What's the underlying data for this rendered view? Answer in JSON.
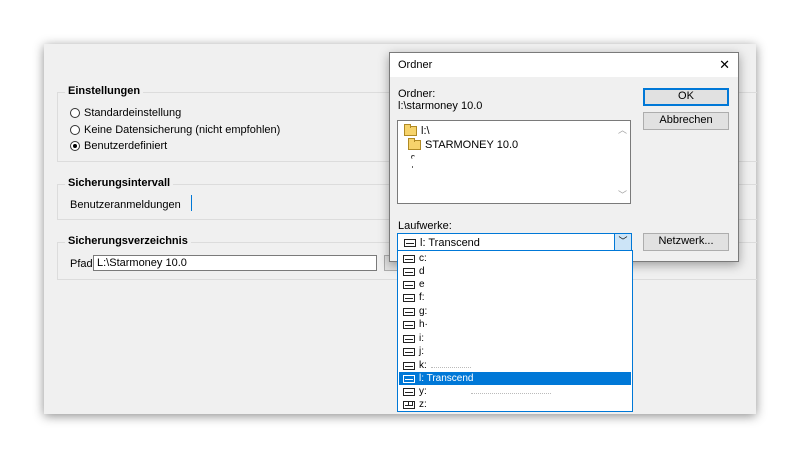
{
  "settings": {
    "group_einstellungen": "Einstellungen",
    "radio_standard": "Standardeinstellung",
    "radio_keine": "Keine Datensicherung (nicht empfohlen)",
    "radio_benutzer": "Benutzerdefiniert",
    "group_intervall": "Sicherungsintervall",
    "intervall_label": "Benutzeranmeldungen",
    "group_verzeichnis": "Sicherungsverzeichnis",
    "pfad_label": "Pfad",
    "pfad_value": "L:\\Starmoney 10.0"
  },
  "dialog": {
    "title": "Ordner",
    "close_glyph": "✕",
    "ordner_label": "Ordner:",
    "ordner_path": "l:\\starmoney 10.0",
    "ok_label": "OK",
    "cancel_label": "Abbrechen",
    "netzwerk_label": "Netzwerk...",
    "folders": [
      "l:\\",
      "STARMONEY 10.0"
    ],
    "laufwerke_label": "Laufwerke:",
    "selected_drive": "l: Transcend",
    "drives": [
      "c:",
      "d",
      "e",
      "f:",
      "g:",
      "h·",
      "i:",
      "j:",
      "k: ",
      "l: Transcend",
      "y:",
      "z:"
    ]
  }
}
